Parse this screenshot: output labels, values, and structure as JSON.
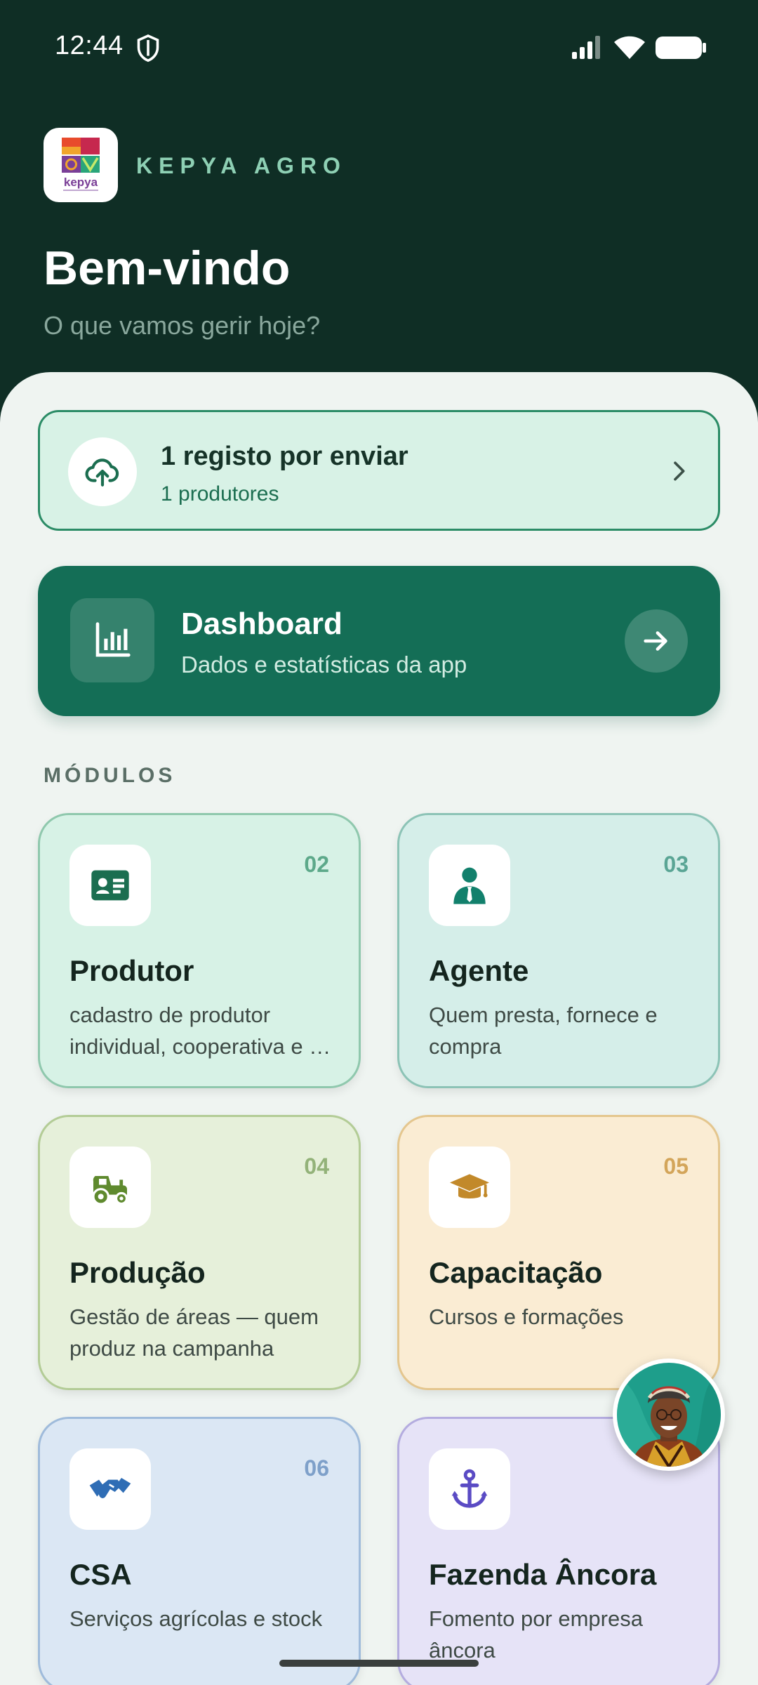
{
  "status_bar": {
    "time": "12:44",
    "icons": [
      "shield-icon",
      "signal-icon",
      "wifi-icon",
      "battery-icon"
    ]
  },
  "header": {
    "brand_name": "KEPYA AGRO",
    "logo_text": "kepya",
    "title": "Bem-vindo",
    "subtitle": "O que vamos gerir hoje?"
  },
  "sync_card": {
    "title": "1 registo por enviar",
    "subtitle": "1 produtores",
    "icon": "cloud-upload-icon"
  },
  "dashboard": {
    "title": "Dashboard",
    "subtitle": "Dados e estatísticas da app",
    "icon": "bar-chart-icon"
  },
  "modules_section": {
    "label": "MÓDULOS",
    "items": [
      {
        "number": "02",
        "title": "Produtor",
        "description": "cadastro de produtor individual, cooperativa e …",
        "icon": "id-card-icon",
        "accent": "#1b6e50"
      },
      {
        "number": "03",
        "title": "Agente",
        "description": "Quem presta, fornece e compra",
        "icon": "agent-person-icon",
        "accent": "#12806c"
      },
      {
        "number": "04",
        "title": "Produção",
        "description": "Gestão de áreas — quem produz na campanha",
        "icon": "tractor-icon",
        "accent": "#5f8a2e"
      },
      {
        "number": "05",
        "title": "Capacitação",
        "description": "Cursos e formações",
        "icon": "graduation-cap-icon",
        "accent": "#c2892a"
      },
      {
        "number": "06",
        "title": "CSA",
        "description": "Serviços agrícolas e stock",
        "icon": "handshake-icon",
        "accent": "#2f6db5"
      },
      {
        "number": "",
        "title": "Fazenda Âncora",
        "description": "Fomento por empresa âncora",
        "icon": "anchor-icon",
        "accent": "#5a4bc4"
      }
    ]
  }
}
